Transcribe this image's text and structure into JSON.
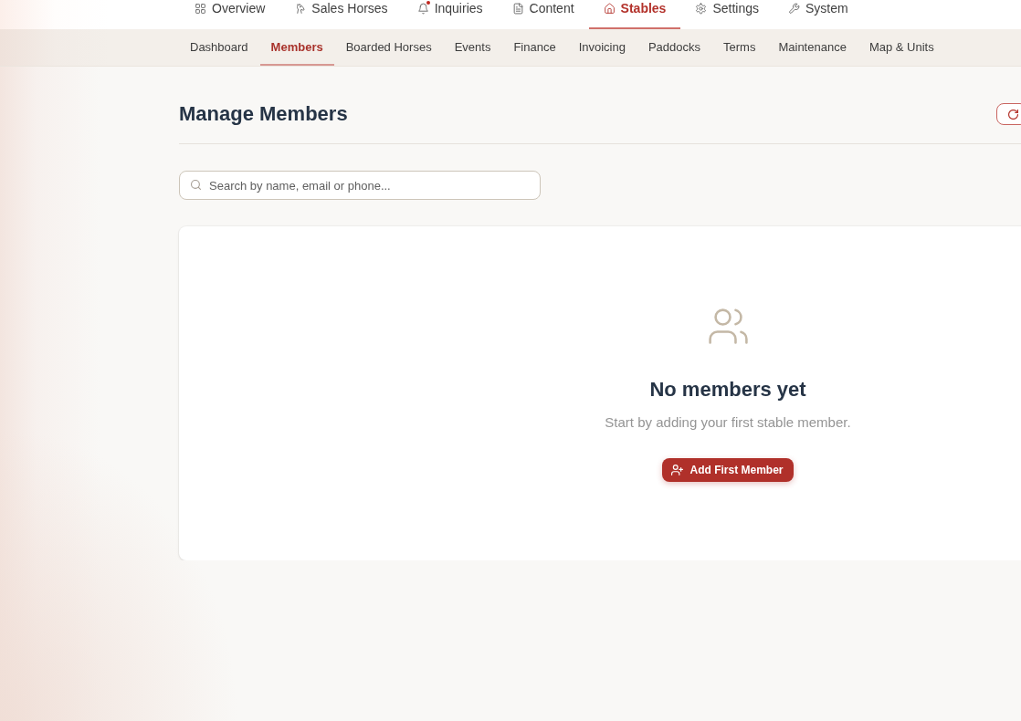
{
  "top_nav": {
    "items": [
      {
        "label": "Overview",
        "selected": false,
        "alert": false
      },
      {
        "label": "Sales Horses",
        "selected": false,
        "alert": false
      },
      {
        "label": "Inquiries",
        "selected": false,
        "alert": true
      },
      {
        "label": "Content",
        "selected": false,
        "alert": false
      },
      {
        "label": "Stables",
        "selected": true,
        "alert": false
      },
      {
        "label": "Settings",
        "selected": false,
        "alert": false
      },
      {
        "label": "System",
        "selected": false,
        "alert": false
      }
    ]
  },
  "sub_nav": {
    "items": [
      {
        "label": "Dashboard",
        "selected": false
      },
      {
        "label": "Members",
        "selected": true
      },
      {
        "label": "Boarded Horses",
        "selected": false
      },
      {
        "label": "Events",
        "selected": false
      },
      {
        "label": "Finance",
        "selected": false
      },
      {
        "label": "Invoicing",
        "selected": false
      },
      {
        "label": "Paddocks",
        "selected": false
      },
      {
        "label": "Terms",
        "selected": false
      },
      {
        "label": "Maintenance",
        "selected": false
      },
      {
        "label": "Map & Units",
        "selected": false
      }
    ]
  },
  "page": {
    "title": "Manage Members"
  },
  "search": {
    "placeholder": "Search by name, email or phone..."
  },
  "empty_state": {
    "title": "No members yet",
    "message": "Start by adding your first stable member.",
    "button": "Add First Member"
  }
}
